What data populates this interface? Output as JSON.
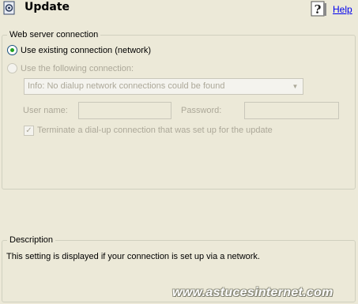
{
  "header": {
    "title": "Update",
    "help_label": "Help"
  },
  "web_server": {
    "legend": "Web server connection",
    "radio_existing_label": "Use existing connection (network)",
    "radio_following_label": "Use the following connection:",
    "connection_dropdown_value": "Info: No dialup network connections could be found",
    "username_label": "User name:",
    "password_label": "Password:",
    "username_value": "",
    "password_value": "",
    "terminate_label": "Terminate a dial-up connection that was set up for the update"
  },
  "description": {
    "legend": "Description",
    "text": "This setting is displayed if your connection is set up via a network."
  },
  "watermark": "www.astucesinternet.com",
  "icons": {
    "app": "update-window-icon",
    "help": "help-question-icon",
    "dropdown": "chevron-down-icon",
    "check": "checkmark-icon"
  },
  "colors": {
    "background": "#ece9d8",
    "link": "#0000ee",
    "radio_dot": "#21a121",
    "disabled": "#aca899"
  }
}
